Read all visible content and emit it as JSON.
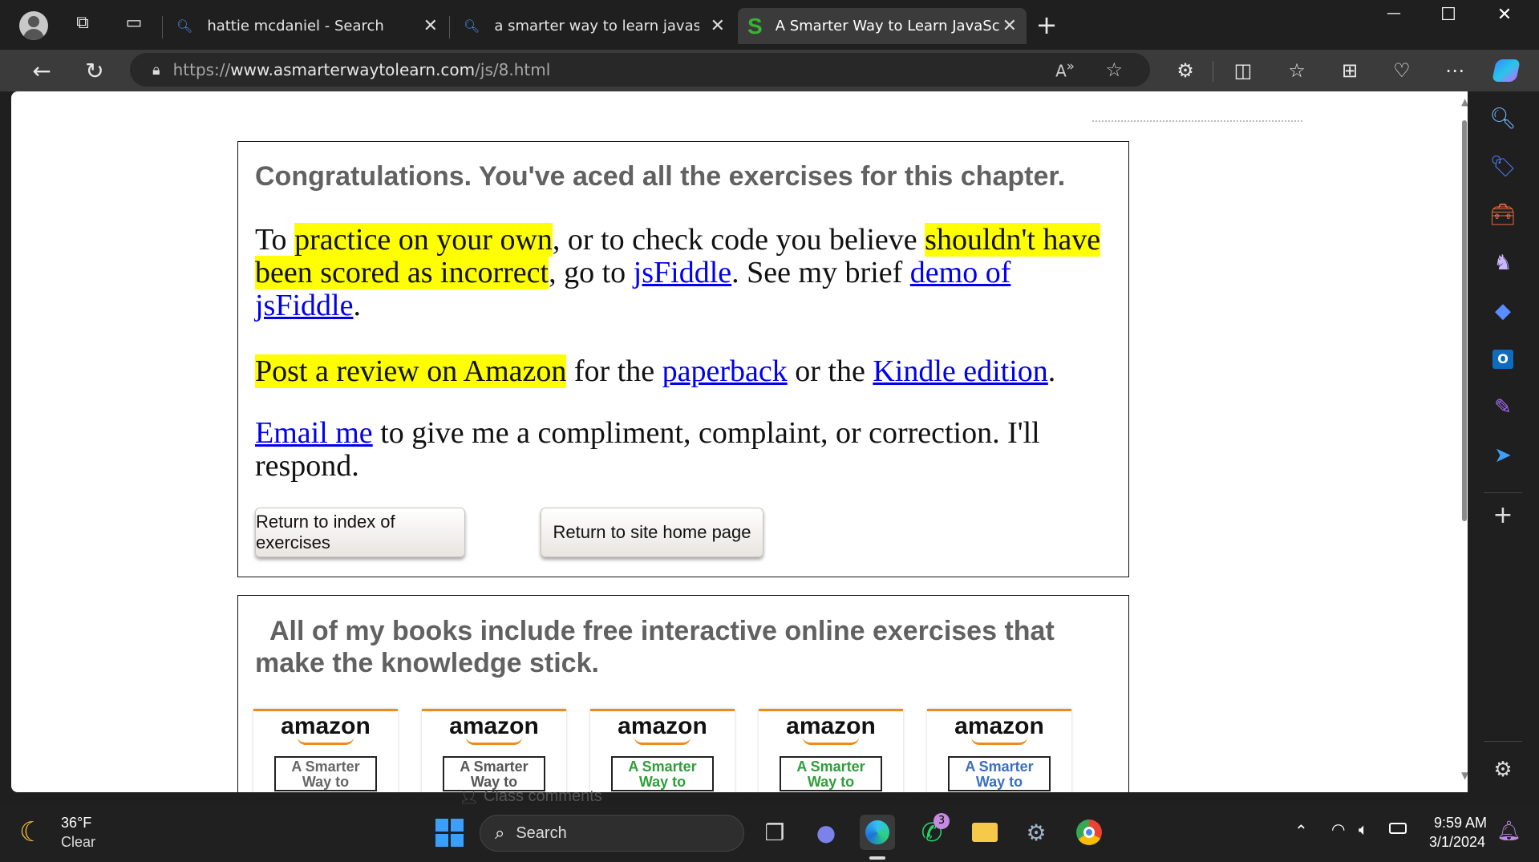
{
  "tabs": [
    {
      "title": "hattie mcdaniel - Search",
      "icon": "search-icon"
    },
    {
      "title": "a smarter way to learn javascript",
      "icon": "search-icon"
    },
    {
      "title": "A Smarter Way to Learn JavaScrip",
      "icon": "s-logo-icon",
      "active": true
    }
  ],
  "new_tab": "+",
  "window_controls": {
    "minimize": "—",
    "maximize": "☐",
    "close": "✕"
  },
  "address": {
    "prefix": "https://",
    "host": "www.asmarterwaytolearn.com",
    "path": "/js/8.html"
  },
  "content": {
    "congrats": "Congratulations. You've aced all the exercises for this chapter.",
    "p1": {
      "t1": "To ",
      "h1": "practice on your own",
      "t2": ", or to check code you believe ",
      "h2": "shouldn't have been scored as incorrect",
      "t3": ", go to ",
      "link1": "jsFiddle",
      "t4": ". See my brief ",
      "link2": "demo of jsFiddle",
      "t5": "."
    },
    "p2": {
      "h1": "Post a review on Amazon",
      "t1": " for the ",
      "link1": "paperback",
      "t2": " or the ",
      "link2": "Kindle edition",
      "t3": "."
    },
    "p3": {
      "link1": "Email me",
      "t1": " to give me a compliment, complaint, or correction. I'll respond."
    },
    "buttons": {
      "index": "Return to index of exercises",
      "home": "Return to site home page"
    },
    "books_heading": "All of my books include free interactive online exercises that make the knowledge stick.",
    "books": [
      {
        "brand": "amazon",
        "subtitle": "A Smarter Way to",
        "color": "#666666"
      },
      {
        "brand": "amazon",
        "subtitle": "A Smarter Way to",
        "color": "#555555"
      },
      {
        "brand": "amazon",
        "subtitle": "A Smarter Way to",
        "color": "#2e9e3a"
      },
      {
        "brand": "amazon",
        "subtitle": "A Smarter Way to",
        "color": "#2e9e3a"
      },
      {
        "brand": "amazon",
        "subtitle": "A Smarter Way to",
        "color": "#3a6fc4"
      }
    ],
    "overlay_text": "Class comments"
  },
  "taskbar": {
    "weather": {
      "temp": "36°F",
      "condition": "Clear"
    },
    "search_label": "Search",
    "whatsapp_badge": "3",
    "clock": {
      "time": "9:59 AM",
      "date": "3/1/2024"
    }
  }
}
